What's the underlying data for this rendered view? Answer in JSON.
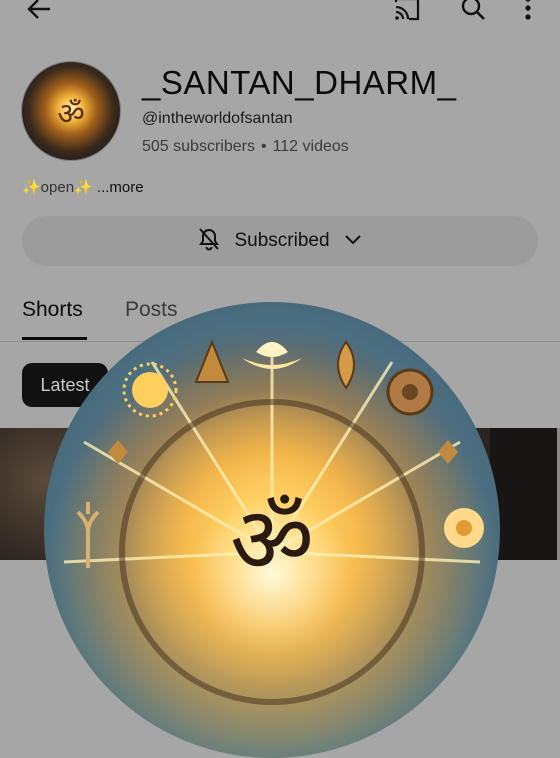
{
  "topbar": {
    "back_icon": "arrow-left-icon",
    "cast_icon": "cast-icon",
    "search_icon": "search-icon",
    "more_icon": "more-vert-icon"
  },
  "channel": {
    "title": "_SANTAN_DHARM_",
    "handle": "@intheworldofsantan",
    "subscribers": "505 subscribers",
    "separator": "•",
    "videos": "112 videos",
    "avatar_symbol": "ॐ"
  },
  "description": {
    "text": "✨open✨",
    "more_label": "...more"
  },
  "subscribe_button": {
    "label": "Subscribed",
    "bell_icon": "bell-off-icon",
    "chevron_icon": "chevron-down-icon"
  },
  "tabs": [
    {
      "label": "Shorts",
      "selected": true
    },
    {
      "label": "Posts",
      "selected": false
    }
  ],
  "filter_chips": [
    {
      "label": "Latest",
      "selected": true
    }
  ],
  "overlay_image": {
    "center_symbol": "ॐ",
    "colors": {
      "glow": "#ffd36b",
      "sky": "#4b6e80",
      "gold": "#e9a13b"
    }
  },
  "colors": {
    "background": "#a6a6a6",
    "button": "#9c9c9c",
    "chip": "#111111",
    "text": "#0b0b0b"
  }
}
